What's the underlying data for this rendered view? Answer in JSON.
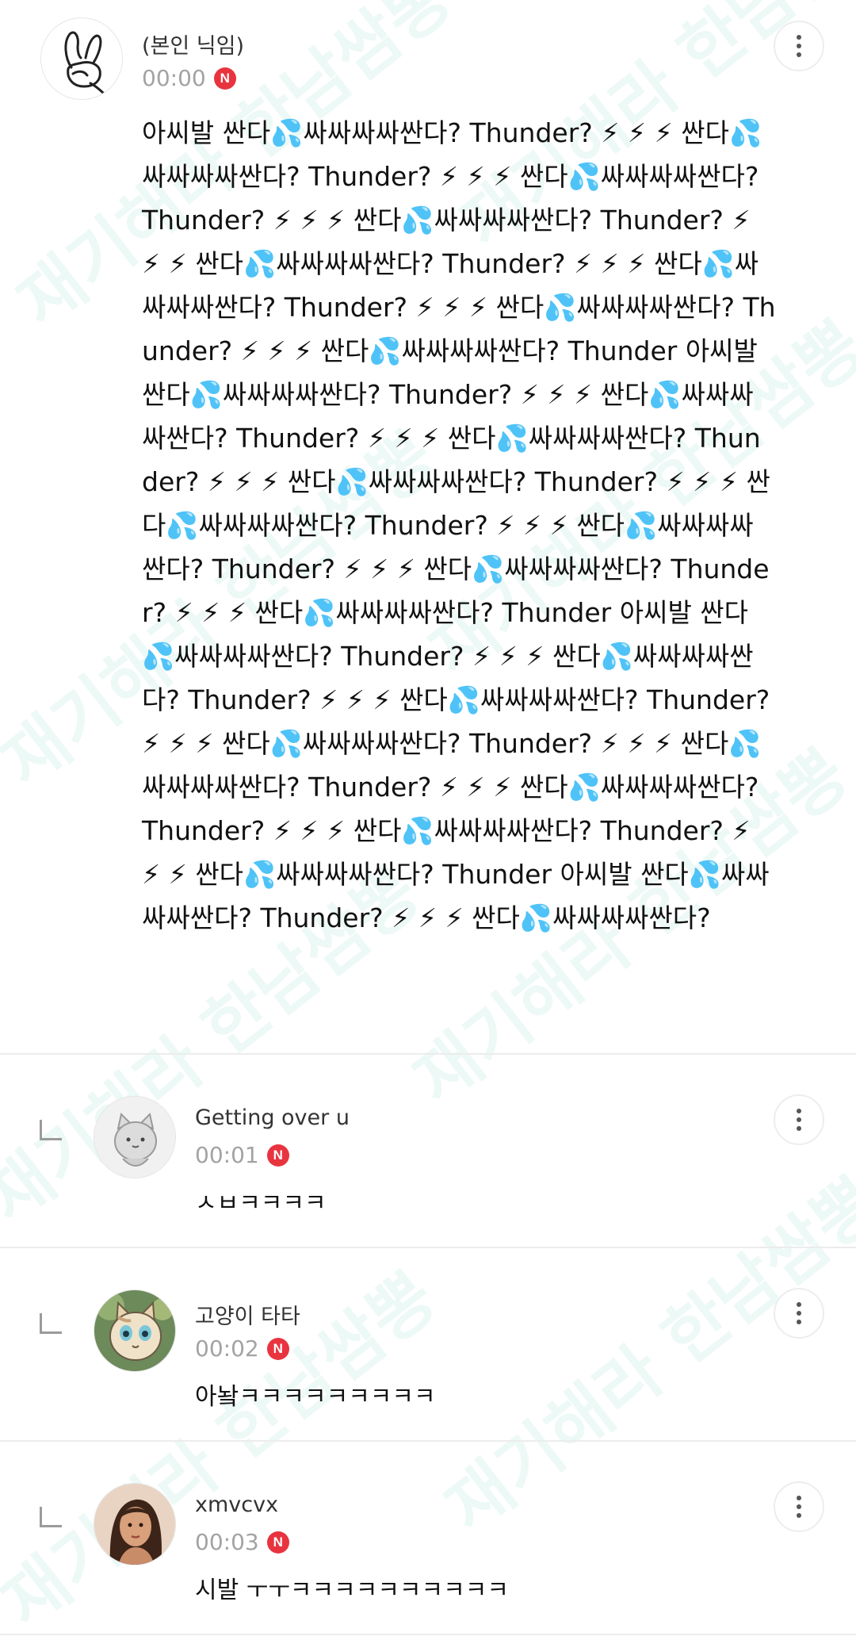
{
  "watermark": {
    "text": "재기해라 한남쌈뽕"
  },
  "main_comment": {
    "nickname": "(본인 닉임)",
    "time": "00:00",
    "badge": "N",
    "text": "아씨발 싼다💦싸싸싸싸싼다? Thunder? ⚡ ⚡ ⚡ 싼다💦싸싸싸싸싼다? Thunder? ⚡ ⚡ ⚡ 싼다💦싸싸싸싸싼다? Thunder? ⚡ ⚡ ⚡ 싼다💦싸싸싸싸싼다? Thunder? ⚡ ⚡ ⚡ 싼다💦싸싸싸싸싼다? Thunder? ⚡ ⚡ ⚡ 싼다💦싸싸싸싸싼다? Thunder? ⚡ ⚡ ⚡ 싼다💦싸싸싸싸싼다? Thunder? ⚡ ⚡ ⚡ 싼다💦싸싸싸싸싼다? Thunder 아씨발 싼다💦싸싸싸싸싼다? Thunder? ⚡ ⚡ ⚡ 싼다💦싸싸싸싸싼다? Thunder? ⚡ ⚡ ⚡ 싼다💦싸싸싸싸싼다? Thunder? ⚡ ⚡ ⚡ 싼다💦싸싸싸싸싼다? Thunder? ⚡ ⚡ ⚡ 싼다💦싸싸싸싸싼다? Thunder? ⚡ ⚡ ⚡ 싼다💦싸싸싸싸싼다? Thunder? ⚡ ⚡ ⚡ 싼다💦싸싸싸싸싼다? Thunder? ⚡ ⚡ ⚡ 싼다💦싸싸싸싸싼다? Thunder 아씨발 싼다💦싸싸싸싸싼다? Thunder? ⚡ ⚡ ⚡ 싼다💦싸싸싸싸싼다? Thunder? ⚡ ⚡ ⚡ 싼다💦싸싸싸싸싼다? Thunder? ⚡ ⚡ ⚡ 싼다💦싸싸싸싸싼다? Thunder? ⚡ ⚡ ⚡ 싼다💦싸싸싸싸싼다? Thunder? ⚡ ⚡ ⚡ 싼다💦싸싸싸싸싼다? Thunder? ⚡ ⚡ ⚡ 싼다💦싸싸싸싸싼다? Thunder? ⚡ ⚡ ⚡ 싼다💦싸싸싸싸싼다? Thunder 아씨발 싼다💦싸싸싸싸싼다? Thunder? ⚡ ⚡ ⚡ 싼다💦싸싸싸싸싼다?"
  },
  "replies": [
    {
      "nickname": "Getting over u",
      "time": "00:01",
      "badge": "N",
      "text": "ㅅㅂㅋㅋㅋㅋ",
      "avatar": "gray-cat-avatar"
    },
    {
      "nickname": "고양이 타타",
      "time": "00:02",
      "badge": "N",
      "text": "아놬ㅋㅋㅋㅋㅋㅋㅋㅋㅋ",
      "avatar": "cartoon-cat-avatar"
    },
    {
      "nickname": "xmvcvx",
      "time": "00:03",
      "badge": "N",
      "text": "시발 ㅜㅜㅋㅋㅋㅋㅋㅋㅋㅋㅋㅋ",
      "avatar": "woman-photo-avatar"
    }
  ],
  "colors": {
    "badge": "#e8343f",
    "time": "#a3a3a3",
    "watermark": "#10b08a"
  }
}
